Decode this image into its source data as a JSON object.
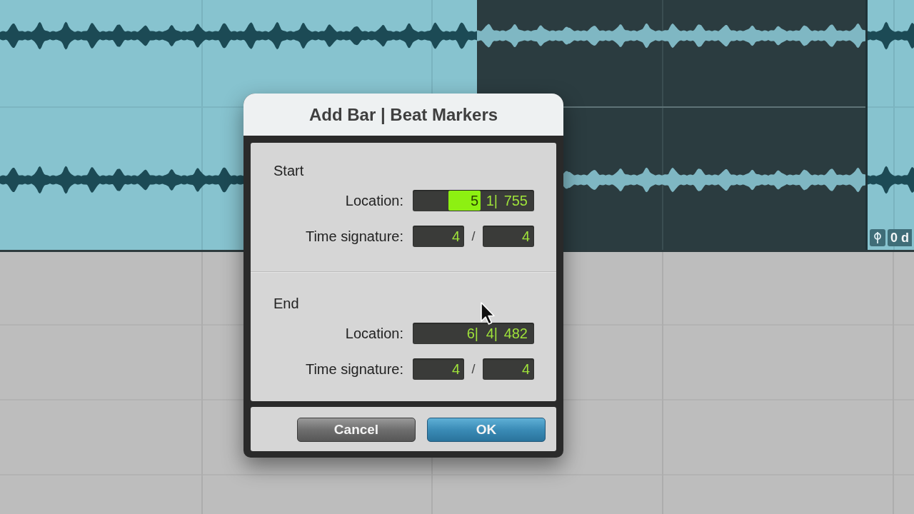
{
  "timeline": {
    "clips": [
      {
        "selected": false
      },
      {
        "selected": true
      },
      {
        "selected": false,
        "gain_label": "0 d"
      }
    ]
  },
  "dialog": {
    "title": "Add Bar | Beat Markers",
    "sections": [
      {
        "heading": "Start",
        "location_label": "Location:",
        "location": [
          {
            "text": "5",
            "selected": true
          },
          {
            "text": "1|",
            "selected": false
          },
          {
            "text": "755",
            "selected": false
          }
        ],
        "time_signature_label": "Time signature:",
        "numerator": "4",
        "separator": "/",
        "denominator": "4"
      },
      {
        "heading": "End",
        "location_label": "Location:",
        "location": [
          {
            "text": "6|",
            "selected": false
          },
          {
            "text": "4|",
            "selected": false
          },
          {
            "text": "482",
            "selected": false
          }
        ],
        "time_signature_label": "Time signature:",
        "numerator": "4",
        "separator": "/",
        "denominator": "4"
      }
    ],
    "buttons": [
      {
        "label": "Cancel",
        "kind": "secondary"
      },
      {
        "label": "OK",
        "kind": "primary"
      }
    ]
  }
}
